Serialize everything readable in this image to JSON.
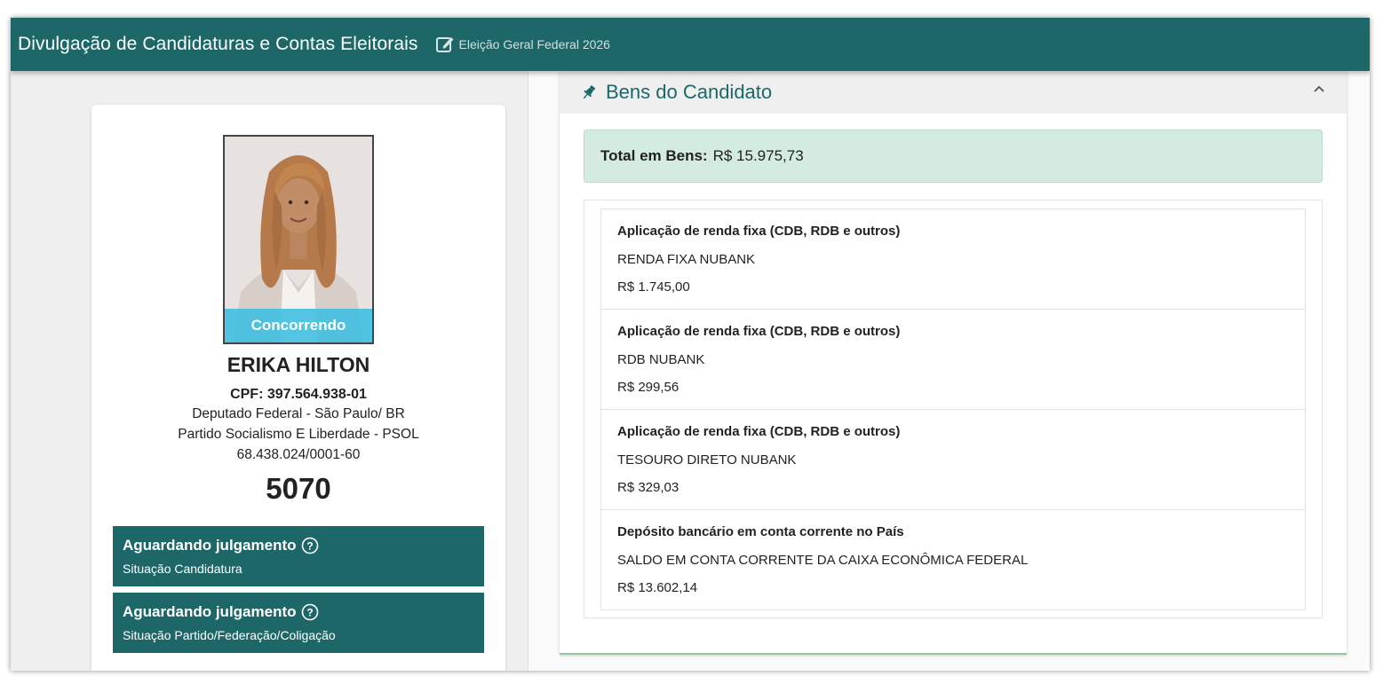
{
  "header": {
    "title": "Divulgação de Candidaturas e Contas Eleitorais",
    "edit_icon": "edit-icon",
    "election": "Eleição Geral Federal 2026",
    "color": "#1e6769"
  },
  "candidate": {
    "status_badge": "Concorrendo",
    "name": "ERIKA HILTON",
    "cpf": "CPF: 397.564.938-01",
    "office": "Deputado Federal - São Paulo/ BR",
    "party": "Partido Socialismo E Liberdade - PSOL",
    "cnpj": "68.438.024/0001-60",
    "number": "5070",
    "statuses": [
      {
        "title": "Aguardando julgamento",
        "subtitle": "Situação Candidatura"
      },
      {
        "title": "Aguardando julgamento",
        "subtitle": "Situação Partido/Federação/Coligação"
      }
    ]
  },
  "bens": {
    "title": "Bens do Candidato",
    "header_icon": "pin-icon",
    "total_label": "Total em Bens:",
    "total_value": "R$ 15.975,73",
    "items": [
      {
        "type": "Aplicação de renda fixa (CDB, RDB e outros)",
        "description": "RENDA FIXA NUBANK",
        "value": "R$ 1.745,00"
      },
      {
        "type": "Aplicação de renda fixa (CDB, RDB e outros)",
        "description": "RDB NUBANK",
        "value": "R$ 299,56"
      },
      {
        "type": "Aplicação de renda fixa (CDB, RDB e outros)",
        "description": "TESOURO DIRETO NUBANK",
        "value": "R$ 329,03"
      },
      {
        "type": "Depósito bancário em conta corrente no País",
        "description": "SALDO EM CONTA CORRENTE DA CAIXA ECONÔMICA FEDERAL",
        "value": "R$ 13.602,14"
      }
    ]
  }
}
